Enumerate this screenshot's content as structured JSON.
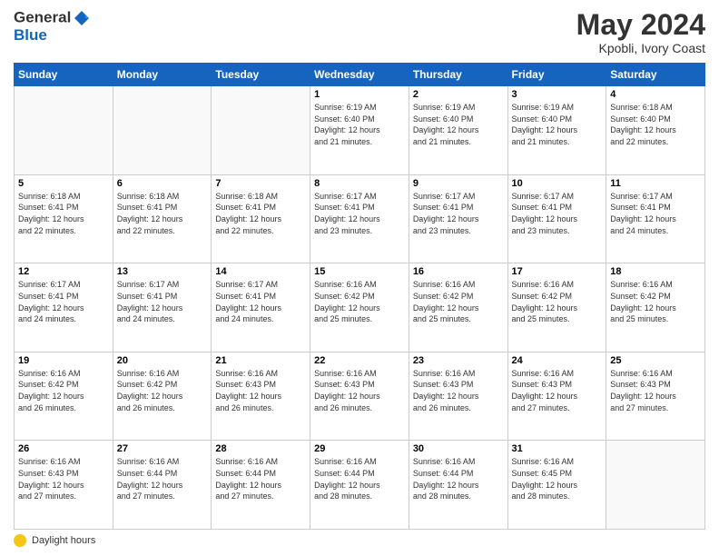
{
  "header": {
    "logo_general": "General",
    "logo_blue": "Blue",
    "month_year": "May 2024",
    "location": "Kpobli, Ivory Coast"
  },
  "days_of_week": [
    "Sunday",
    "Monday",
    "Tuesday",
    "Wednesday",
    "Thursday",
    "Friday",
    "Saturday"
  ],
  "footer": {
    "label": "Daylight hours"
  },
  "weeks": [
    [
      {
        "day": "",
        "detail": ""
      },
      {
        "day": "",
        "detail": ""
      },
      {
        "day": "",
        "detail": ""
      },
      {
        "day": "1",
        "detail": "Sunrise: 6:19 AM\nSunset: 6:40 PM\nDaylight: 12 hours\nand 21 minutes."
      },
      {
        "day": "2",
        "detail": "Sunrise: 6:19 AM\nSunset: 6:40 PM\nDaylight: 12 hours\nand 21 minutes."
      },
      {
        "day": "3",
        "detail": "Sunrise: 6:19 AM\nSunset: 6:40 PM\nDaylight: 12 hours\nand 21 minutes."
      },
      {
        "day": "4",
        "detail": "Sunrise: 6:18 AM\nSunset: 6:40 PM\nDaylight: 12 hours\nand 22 minutes."
      }
    ],
    [
      {
        "day": "5",
        "detail": "Sunrise: 6:18 AM\nSunset: 6:41 PM\nDaylight: 12 hours\nand 22 minutes."
      },
      {
        "day": "6",
        "detail": "Sunrise: 6:18 AM\nSunset: 6:41 PM\nDaylight: 12 hours\nand 22 minutes."
      },
      {
        "day": "7",
        "detail": "Sunrise: 6:18 AM\nSunset: 6:41 PM\nDaylight: 12 hours\nand 22 minutes."
      },
      {
        "day": "8",
        "detail": "Sunrise: 6:17 AM\nSunset: 6:41 PM\nDaylight: 12 hours\nand 23 minutes."
      },
      {
        "day": "9",
        "detail": "Sunrise: 6:17 AM\nSunset: 6:41 PM\nDaylight: 12 hours\nand 23 minutes."
      },
      {
        "day": "10",
        "detail": "Sunrise: 6:17 AM\nSunset: 6:41 PM\nDaylight: 12 hours\nand 23 minutes."
      },
      {
        "day": "11",
        "detail": "Sunrise: 6:17 AM\nSunset: 6:41 PM\nDaylight: 12 hours\nand 24 minutes."
      }
    ],
    [
      {
        "day": "12",
        "detail": "Sunrise: 6:17 AM\nSunset: 6:41 PM\nDaylight: 12 hours\nand 24 minutes."
      },
      {
        "day": "13",
        "detail": "Sunrise: 6:17 AM\nSunset: 6:41 PM\nDaylight: 12 hours\nand 24 minutes."
      },
      {
        "day": "14",
        "detail": "Sunrise: 6:17 AM\nSunset: 6:41 PM\nDaylight: 12 hours\nand 24 minutes."
      },
      {
        "day": "15",
        "detail": "Sunrise: 6:16 AM\nSunset: 6:42 PM\nDaylight: 12 hours\nand 25 minutes."
      },
      {
        "day": "16",
        "detail": "Sunrise: 6:16 AM\nSunset: 6:42 PM\nDaylight: 12 hours\nand 25 minutes."
      },
      {
        "day": "17",
        "detail": "Sunrise: 6:16 AM\nSunset: 6:42 PM\nDaylight: 12 hours\nand 25 minutes."
      },
      {
        "day": "18",
        "detail": "Sunrise: 6:16 AM\nSunset: 6:42 PM\nDaylight: 12 hours\nand 25 minutes."
      }
    ],
    [
      {
        "day": "19",
        "detail": "Sunrise: 6:16 AM\nSunset: 6:42 PM\nDaylight: 12 hours\nand 26 minutes."
      },
      {
        "day": "20",
        "detail": "Sunrise: 6:16 AM\nSunset: 6:42 PM\nDaylight: 12 hours\nand 26 minutes."
      },
      {
        "day": "21",
        "detail": "Sunrise: 6:16 AM\nSunset: 6:43 PM\nDaylight: 12 hours\nand 26 minutes."
      },
      {
        "day": "22",
        "detail": "Sunrise: 6:16 AM\nSunset: 6:43 PM\nDaylight: 12 hours\nand 26 minutes."
      },
      {
        "day": "23",
        "detail": "Sunrise: 6:16 AM\nSunset: 6:43 PM\nDaylight: 12 hours\nand 26 minutes."
      },
      {
        "day": "24",
        "detail": "Sunrise: 6:16 AM\nSunset: 6:43 PM\nDaylight: 12 hours\nand 27 minutes."
      },
      {
        "day": "25",
        "detail": "Sunrise: 6:16 AM\nSunset: 6:43 PM\nDaylight: 12 hours\nand 27 minutes."
      }
    ],
    [
      {
        "day": "26",
        "detail": "Sunrise: 6:16 AM\nSunset: 6:43 PM\nDaylight: 12 hours\nand 27 minutes."
      },
      {
        "day": "27",
        "detail": "Sunrise: 6:16 AM\nSunset: 6:44 PM\nDaylight: 12 hours\nand 27 minutes."
      },
      {
        "day": "28",
        "detail": "Sunrise: 6:16 AM\nSunset: 6:44 PM\nDaylight: 12 hours\nand 27 minutes."
      },
      {
        "day": "29",
        "detail": "Sunrise: 6:16 AM\nSunset: 6:44 PM\nDaylight: 12 hours\nand 28 minutes."
      },
      {
        "day": "30",
        "detail": "Sunrise: 6:16 AM\nSunset: 6:44 PM\nDaylight: 12 hours\nand 28 minutes."
      },
      {
        "day": "31",
        "detail": "Sunrise: 6:16 AM\nSunset: 6:45 PM\nDaylight: 12 hours\nand 28 minutes."
      },
      {
        "day": "",
        "detail": ""
      }
    ]
  ]
}
